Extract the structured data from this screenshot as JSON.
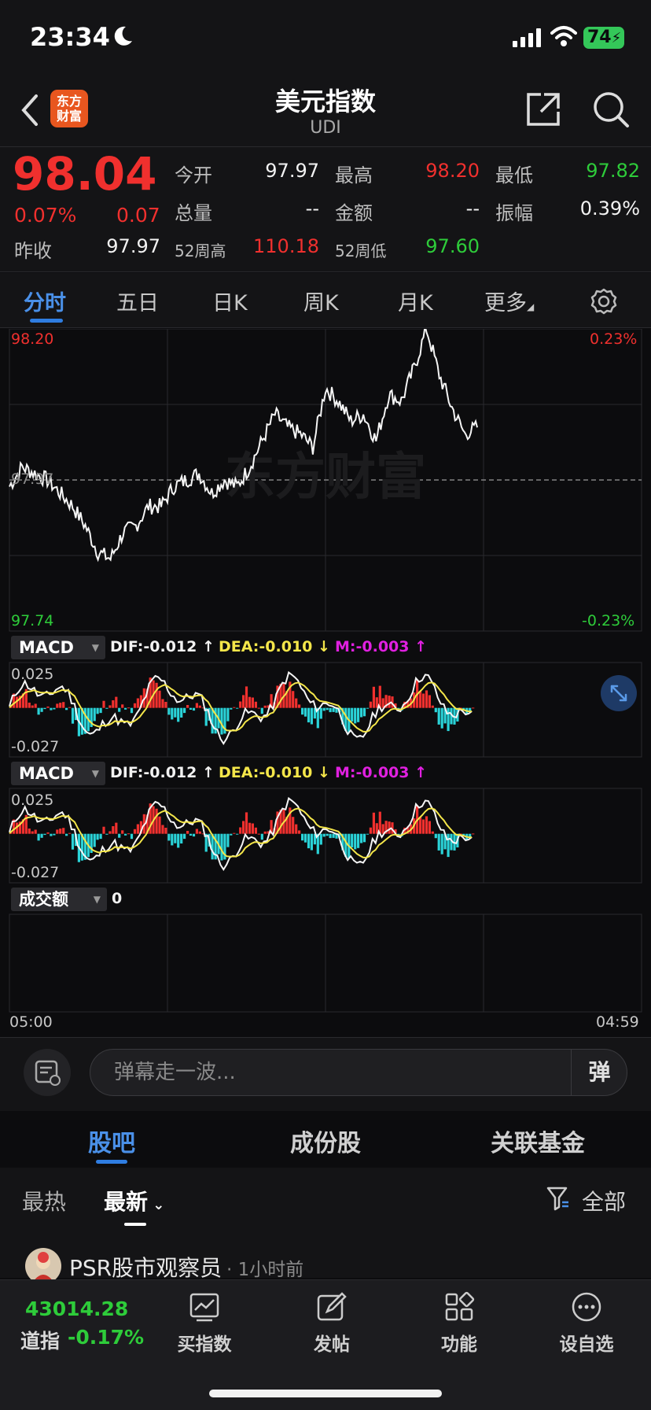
{
  "status_bar": {
    "time": "23:34",
    "battery": "74"
  },
  "header": {
    "title": "美元指数",
    "subtitle": "UDI",
    "logo_text_line1": "东方",
    "logo_text_line2": "财富"
  },
  "quote": {
    "last": "98.04",
    "change_pct": "0.07%",
    "change_abs": "0.07",
    "prev_close_label": "昨收",
    "prev_close": "97.97",
    "open_label": "今开",
    "open": "97.97",
    "high_label": "最高",
    "high": "98.20",
    "low_label": "最低",
    "low": "97.82",
    "volume_label": "总量",
    "volume": "--",
    "amount_label": "金额",
    "amount": "--",
    "amplitude_label": "振幅",
    "amplitude": "0.39%",
    "w52_high_label": "52周高",
    "w52_high": "110.18",
    "w52_low_label": "52周低",
    "w52_low": "97.60"
  },
  "chart_tabs": [
    "分时",
    "五日",
    "日K",
    "周K",
    "月K",
    "更多"
  ],
  "chart_data": [
    {
      "type": "line",
      "y_axis_left": [
        "98.20",
        "97.97",
        "97.74"
      ],
      "y_axis_right": [
        "0.23%",
        "-0.23%"
      ],
      "x_axis": [
        "05:00",
        "04:59"
      ],
      "ylim": [
        97.74,
        98.2
      ],
      "reference": 97.97,
      "watermark": "东方财富",
      "x": [
        0,
        2,
        4,
        6,
        8,
        10,
        12,
        14,
        16,
        18,
        20,
        22,
        24,
        26,
        28,
        30,
        32,
        34,
        36,
        38,
        40,
        42,
        44,
        46,
        48,
        50,
        52,
        54,
        56,
        58,
        60,
        62,
        64,
        66,
        68,
        70,
        72,
        74
      ],
      "y": [
        97.96,
        97.99,
        97.98,
        97.97,
        97.95,
        97.93,
        97.9,
        97.86,
        97.85,
        97.89,
        97.9,
        97.93,
        97.93,
        97.96,
        97.97,
        97.98,
        97.95,
        97.97,
        97.96,
        97.99,
        98.03,
        98.07,
        98.05,
        98.04,
        98.02,
        98.11,
        98.09,
        98.06,
        98.07,
        98.03,
        98.1,
        98.09,
        98.14,
        98.2,
        98.13,
        98.08,
        98.04,
        98.05
      ]
    },
    {
      "type": "bar",
      "indicator": "MACD",
      "dif": "DIF:-0.012 ↑",
      "dea": "DEA:-0.010 ↓",
      "m": "M:-0.003 ↑",
      "y_axis": [
        "0.025",
        "-0.027"
      ],
      "ylim": [
        -0.027,
        0.025
      ]
    },
    {
      "type": "bar",
      "indicator": "MACD",
      "dif": "DIF:-0.012 ↑",
      "dea": "DEA:-0.010 ↓",
      "m": "M:-0.003 ↑",
      "y_axis": [
        "0.025",
        "-0.027"
      ],
      "ylim": [
        -0.027,
        0.025
      ]
    },
    {
      "type": "bar",
      "indicator": "成交额",
      "value": "0",
      "values": []
    }
  ],
  "danmaku": {
    "placeholder": "弹幕走一波...",
    "send": "弹"
  },
  "community_tabs": [
    "股吧",
    "成份股",
    "关联基金"
  ],
  "feed_filter": {
    "hot": "最热",
    "new": "最新",
    "all": "全部"
  },
  "post": {
    "author": "PSR股市观察员",
    "time": "· 1小时前"
  },
  "bottom_bar": {
    "index_value": "43014.28",
    "index_name": "道指",
    "index_change": "-0.17%",
    "nav": [
      "买指数",
      "发帖",
      "功能",
      "设自选"
    ]
  },
  "colors": {
    "up": "#f0302e",
    "down": "#2ecc3a",
    "accent": "#2f7de1",
    "dea": "#f4e64a",
    "m": "#e020e0",
    "macd_neg": "#2ad3d8"
  }
}
